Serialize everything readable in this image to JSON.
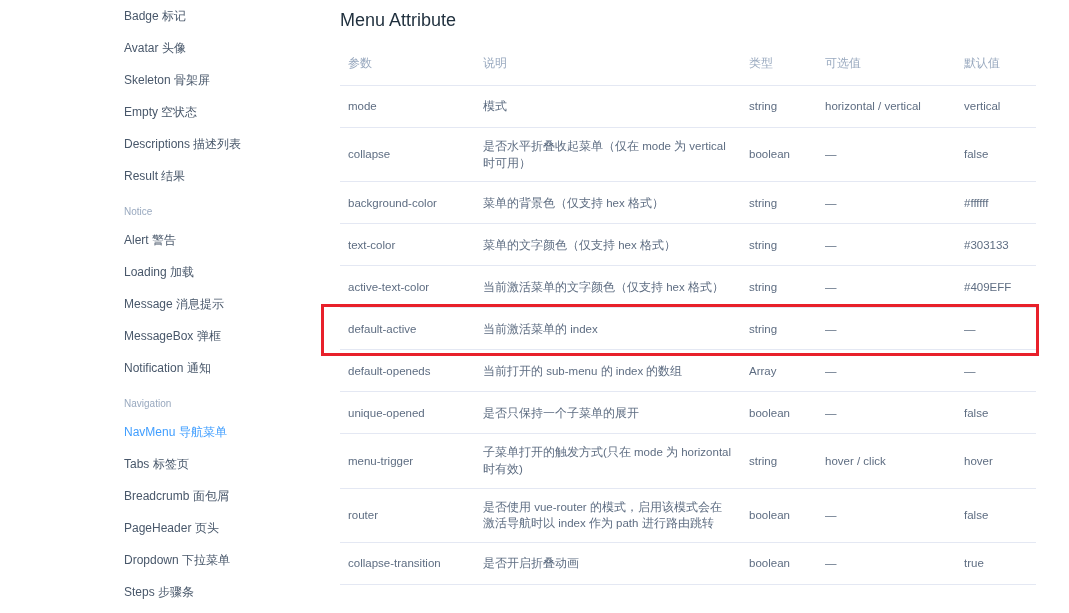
{
  "sidebar": {
    "groups": [
      {
        "items": [
          {
            "label": "Badge 标记",
            "selected": false
          },
          {
            "label": "Avatar 头像",
            "selected": false
          },
          {
            "label": "Skeleton 骨架屏",
            "selected": false
          },
          {
            "label": "Empty 空状态",
            "selected": false
          },
          {
            "label": "Descriptions 描述列表",
            "selected": false
          },
          {
            "label": "Result 结果",
            "selected": false
          }
        ]
      },
      {
        "title": "Notice",
        "items": [
          {
            "label": "Alert 警告",
            "selected": false
          },
          {
            "label": "Loading 加载",
            "selected": false
          },
          {
            "label": "Message 消息提示",
            "selected": false
          },
          {
            "label": "MessageBox 弹框",
            "selected": false
          },
          {
            "label": "Notification 通知",
            "selected": false
          }
        ]
      },
      {
        "title": "Navigation",
        "items": [
          {
            "label": "NavMenu 导航菜单",
            "selected": true
          },
          {
            "label": "Tabs 标签页",
            "selected": false
          },
          {
            "label": "Breadcrumb 面包屑",
            "selected": false
          },
          {
            "label": "PageHeader 页头",
            "selected": false
          },
          {
            "label": "Dropdown 下拉菜单",
            "selected": false
          },
          {
            "label": "Steps 步骤条",
            "selected": false
          }
        ]
      }
    ]
  },
  "title": "Menu Attribute",
  "table": {
    "columns": [
      "参数",
      "说明",
      "类型",
      "可选值",
      "默认值"
    ],
    "rows": [
      {
        "cells": [
          "mode",
          "模式",
          "string",
          "horizontal / vertical",
          "vertical"
        ],
        "highlighted": false
      },
      {
        "cells": [
          "collapse",
          "是否水平折叠收起菜单（仅在 mode 为 vertical 时可用）",
          "boolean",
          "—",
          "false"
        ],
        "highlighted": false
      },
      {
        "cells": [
          "background-color",
          "菜单的背景色（仅支持 hex 格式）",
          "string",
          "—",
          "#ffffff"
        ],
        "highlighted": false
      },
      {
        "cells": [
          "text-color",
          "菜单的文字颜色（仅支持 hex 格式）",
          "string",
          "—",
          "#303133"
        ],
        "highlighted": false
      },
      {
        "cells": [
          "active-text-color",
          "当前激活菜单的文字颜色（仅支持 hex 格式）",
          "string",
          "—",
          "#409EFF"
        ],
        "highlighted": false
      },
      {
        "cells": [
          "default-active",
          "当前激活菜单的 index",
          "string",
          "—",
          "—"
        ],
        "highlighted": true
      },
      {
        "cells": [
          "default-openeds",
          "当前打开的 sub-menu 的 index 的数组",
          "Array",
          "—",
          "—"
        ],
        "highlighted": false
      },
      {
        "cells": [
          "unique-opened",
          "是否只保持一个子菜单的展开",
          "boolean",
          "—",
          "false"
        ],
        "highlighted": false
      },
      {
        "cells": [
          "menu-trigger",
          "子菜单打开的触发方式(只在 mode 为 horizontal 时有效)",
          "string",
          "hover / click",
          "hover"
        ],
        "highlighted": false
      },
      {
        "cells": [
          "router",
          "是否使用 vue-router 的模式，启用该模式会在激活导航时以 index 作为 path 进行路由跳转",
          "boolean",
          "—",
          "false"
        ],
        "highlighted": false
      },
      {
        "cells": [
          "collapse-transition",
          "是否开启折叠动画",
          "boolean",
          "—",
          "true"
        ],
        "highlighted": false
      }
    ]
  }
}
